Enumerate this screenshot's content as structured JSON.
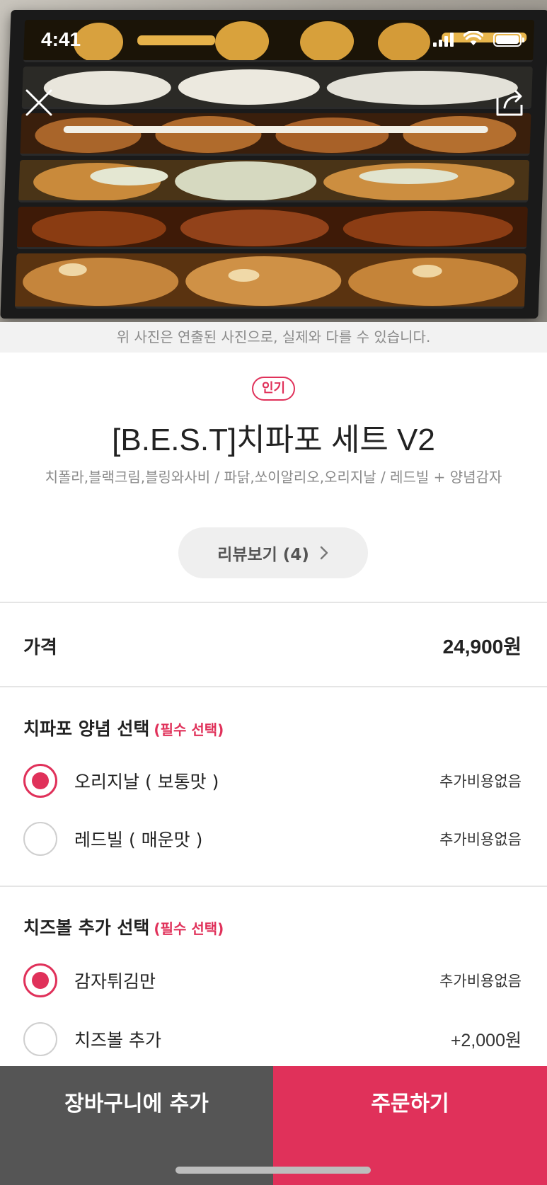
{
  "status_bar": {
    "time": "4:41"
  },
  "hero": {
    "image": "fried-chicken-tray-photo"
  },
  "disclaimer": "위 사진은 연출된 사진으로, 실제와 다를 수 있습니다.",
  "product": {
    "badge": "인기",
    "title": "[B.E.S.T]치파포 세트 V2",
    "description": "치폴라,블랙크림,블링와사비 / 파닭,쏘이알리오,오리지날 / 레드빌 + 양념감자",
    "review_button": "리뷰보기 (4)"
  },
  "price": {
    "label": "가격",
    "value": "24,900원"
  },
  "option_groups": [
    {
      "title": "치파포 양념 선택",
      "required": "(필수 선택)",
      "options": [
        {
          "label": "오리지날 ( 보통맛 )",
          "price": "추가비용없음",
          "selected": true
        },
        {
          "label": "레드빌 ( 매운맛 )",
          "price": "추가비용없음",
          "selected": false
        }
      ]
    },
    {
      "title": "치즈볼 추가 선택",
      "required": "(필수 선택)",
      "options": [
        {
          "label": "감자튀김만",
          "price": "추가비용없음",
          "selected": true
        },
        {
          "label": "치즈볼 추가",
          "price": "+2,000원",
          "selected": false
        }
      ]
    }
  ],
  "bottom_bar": {
    "cart_label": "장바구니에 추가",
    "order_label": "주문하기"
  },
  "colors": {
    "accent": "#e0315a",
    "cart_bg": "#555555",
    "muted_text": "#8a8a8a"
  }
}
